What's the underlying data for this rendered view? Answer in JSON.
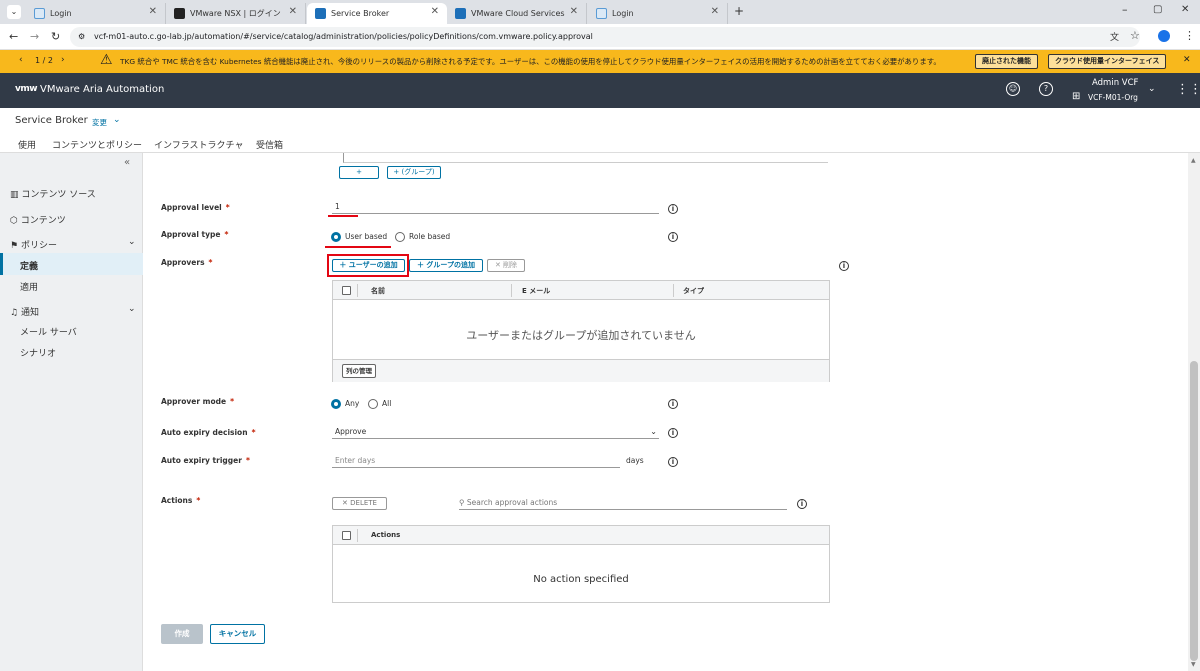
{
  "browser": {
    "tabs": [
      {
        "label": "Login",
        "active": false
      },
      {
        "label": "VMware NSX | ログイン",
        "active": false
      },
      {
        "label": "Service Broker",
        "active": true
      },
      {
        "label": "VMware Cloud Services",
        "active": false
      },
      {
        "label": "Login",
        "active": false
      }
    ],
    "url": "vcf-m01-auto.c.go-lab.jp/automation/#/service/catalog/administration/policies/policyDefinitions/com.vmware.policy.approval"
  },
  "banner": {
    "pager": "1 / 2",
    "message": "TKG 統合や TMC 統合を含む Kubernetes 統合機能は廃止され、今後のリリースの製品から削除される予定です。ユーザーは、この機能の使用を停止してクラウド使用量インターフェイスの活用を開始するための計画を立てておく必要があります。",
    "btn_deprecated": "廃止された機能",
    "btn_cloud_usage": "クラウド使用量インターフェイス"
  },
  "app_header": {
    "logo": "vmw",
    "title": "VMware Aria Automation",
    "user": "Admin VCF",
    "org": "VCF-M01-Org"
  },
  "service_header": {
    "title": "Service Broker",
    "change": "変更",
    "tabs": [
      "使用",
      "コンテンツとポリシー",
      "インフラストラクチャ",
      "受信箱"
    ]
  },
  "sidebar": {
    "items": [
      {
        "label": "コンテンツ ソース"
      },
      {
        "label": "コンテンツ"
      },
      {
        "label": "ポリシー"
      },
      {
        "label": "定義"
      },
      {
        "label": "適用"
      },
      {
        "label": "通知"
      },
      {
        "label": "メール サーバ"
      },
      {
        "label": "シナリオ"
      }
    ]
  },
  "form": {
    "top_buttons": [
      "+",
      "+ (グループ)"
    ],
    "approval_level": {
      "label": "Approval level",
      "value": "1"
    },
    "approval_type": {
      "label": "Approval type",
      "options": [
        "User based",
        "Role based"
      ],
      "selected": "User based"
    },
    "approvers": {
      "label": "Approvers",
      "btn_add_user": "ユーザーの追加",
      "btn_add_group": "グループの追加",
      "btn_delete": "削除",
      "columns": [
        "名前",
        "E メール",
        "タイプ"
      ],
      "empty": "ユーザーまたはグループが追加されていません",
      "manage_columns": "列の管理"
    },
    "approver_mode": {
      "label": "Approver mode",
      "options": [
        "Any",
        "All"
      ],
      "selected": "Any"
    },
    "auto_expiry_decision": {
      "label": "Auto expiry decision",
      "value": "Approve"
    },
    "auto_expiry_trigger": {
      "label": "Auto expiry trigger",
      "placeholder": "Enter days",
      "unit": "days"
    },
    "actions": {
      "label": "Actions",
      "btn_delete": "DELETE",
      "search_placeholder": "Search approval actions",
      "column": "Actions",
      "empty": "No action specified"
    },
    "btn_create": "作成",
    "btn_cancel": "キャンセル"
  },
  "colors": {
    "accent": "#0072a3",
    "header_bg": "#313a47",
    "banner_bg": "#f8b81c",
    "highlight": "#e30613"
  }
}
